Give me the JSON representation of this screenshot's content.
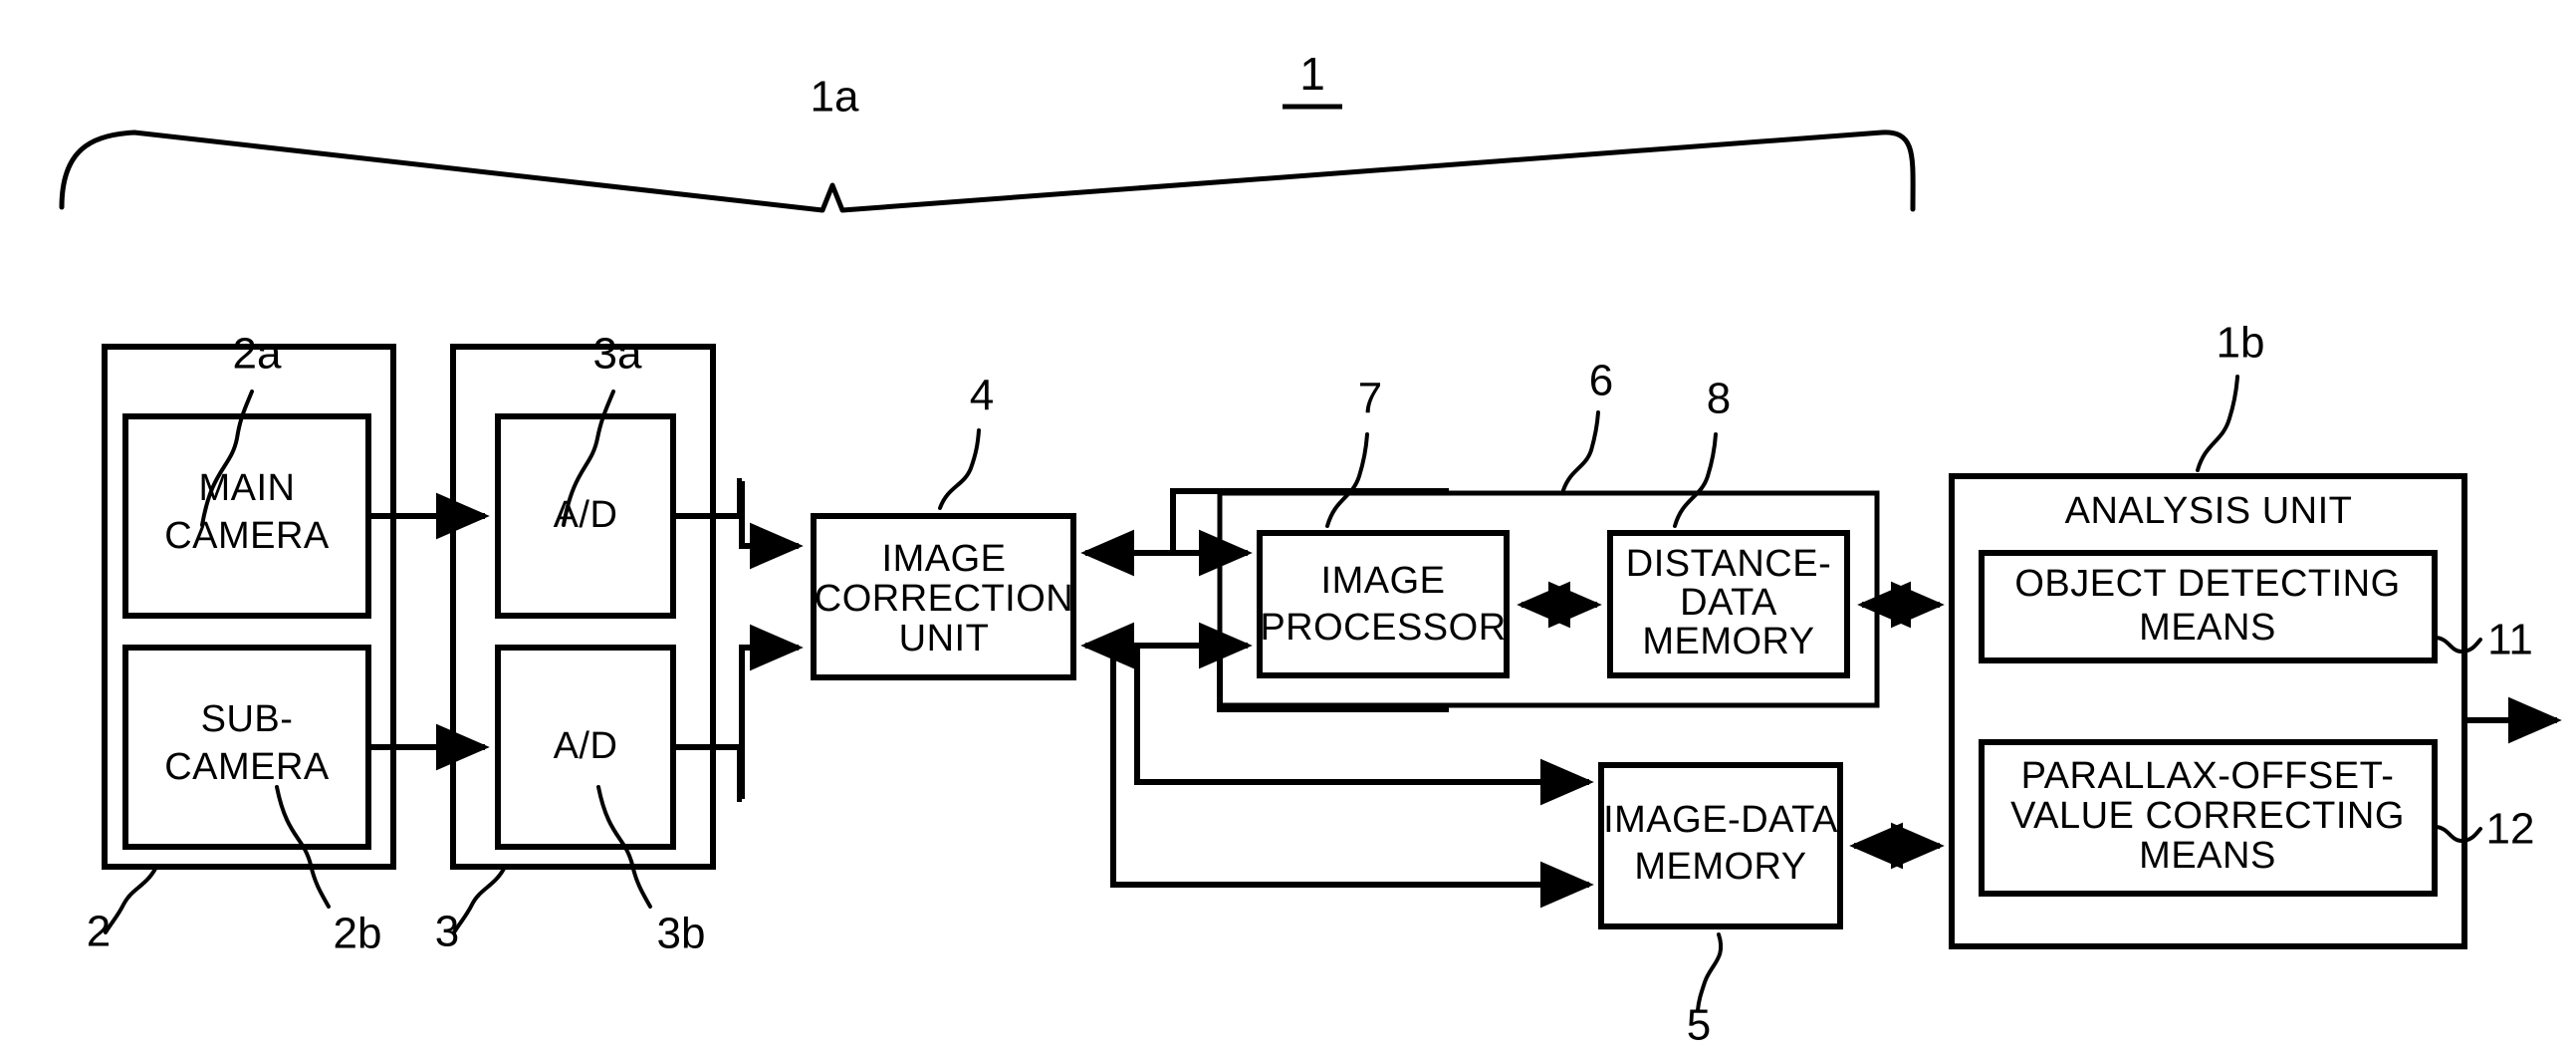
{
  "figure": {
    "system_number": "1",
    "imaging_section_number": "1a",
    "analysis_section_number": "1b"
  },
  "blocks": {
    "main_camera": {
      "lines": [
        "MAIN",
        "CAMERA"
      ],
      "ref": "2a"
    },
    "sub_camera": {
      "lines": [
        "SUB-",
        "CAMERA"
      ],
      "ref": "2b"
    },
    "camera_assembly": {
      "ref": "2"
    },
    "ad_top": {
      "lines": [
        "A/D"
      ],
      "ref": "3a"
    },
    "ad_bottom": {
      "lines": [
        "A/D"
      ],
      "ref": "3b"
    },
    "converter_assembly": {
      "ref": "3"
    },
    "image_correction_unit": {
      "lines": [
        "IMAGE",
        "CORRECTION",
        "UNIT"
      ],
      "ref": "4"
    },
    "image_processor": {
      "lines": [
        "IMAGE",
        "PROCESSOR"
      ],
      "ref": "7"
    },
    "distance_data_memory": {
      "lines": [
        "DISTANCE-",
        "DATA",
        "MEMORY"
      ],
      "ref": "8"
    },
    "processing_group": {
      "ref": "6"
    },
    "image_data_memory": {
      "lines": [
        "IMAGE-DATA",
        "MEMORY"
      ],
      "ref": "5"
    },
    "analysis_unit": {
      "title": "ANALYSIS UNIT",
      "ref": "1b"
    },
    "object_detecting_means": {
      "lines": [
        "OBJECT DETECTING",
        "MEANS"
      ],
      "ref": "11"
    },
    "parallax_offset_means": {
      "lines": [
        "PARALLAX-OFFSET-",
        "VALUE CORRECTING",
        "MEANS"
      ],
      "ref": "12"
    }
  },
  "colors": {
    "ink": "#000000",
    "paper": "#ffffff"
  }
}
